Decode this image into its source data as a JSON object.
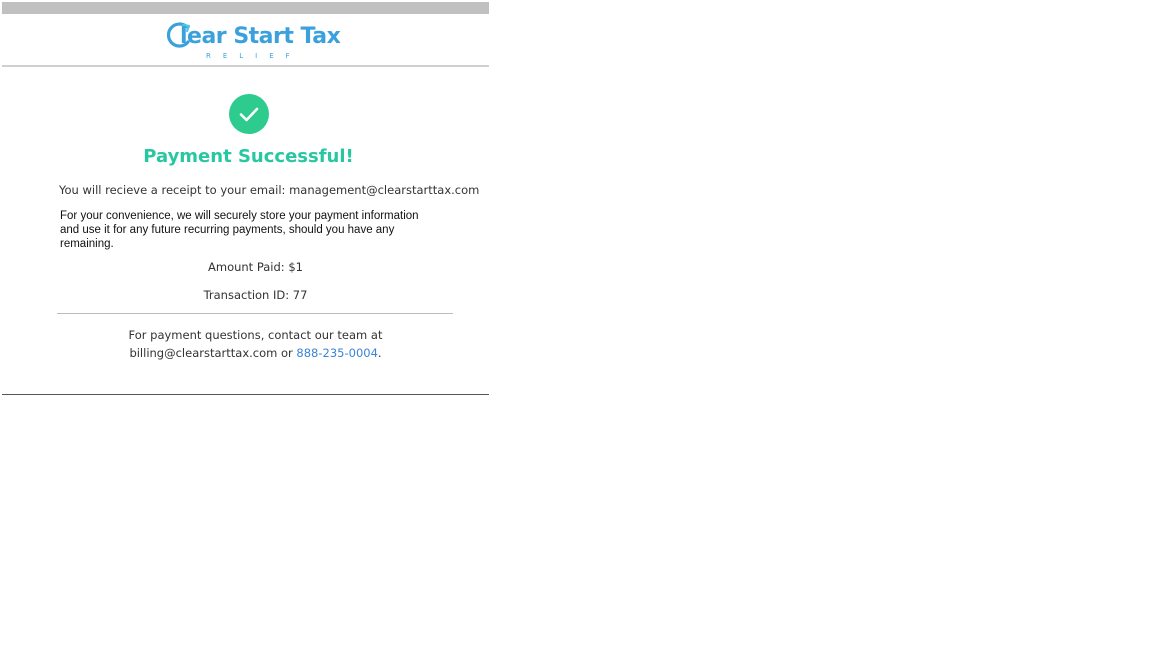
{
  "brand": {
    "name": "Clear Start Tax",
    "name_rest": "lear Start Tax",
    "tagline": "RELIEF",
    "color": "#3ba1dc"
  },
  "status": {
    "title": "Payment Successful!",
    "accent_color": "#27c7a1",
    "check_color": "#2dcc8e",
    "icon": "checkmark-circle-icon"
  },
  "receipt": {
    "text": "You will recieve a receipt to your email: management@clearstarttax.com"
  },
  "convenience": {
    "text": "For your convenience, we will securely store your payment information and use it for any future recurring payments, should you have any remaining."
  },
  "payment": {
    "amount": "Amount Paid: $1",
    "transaction": "Transaction ID: 77"
  },
  "contact": {
    "line1": "For payment questions, contact our team at",
    "email": "billing@clearstarttax.com",
    "or": " or ",
    "phone": "888-235-0004",
    "end": ".",
    "link_color": "#3a84d6"
  }
}
